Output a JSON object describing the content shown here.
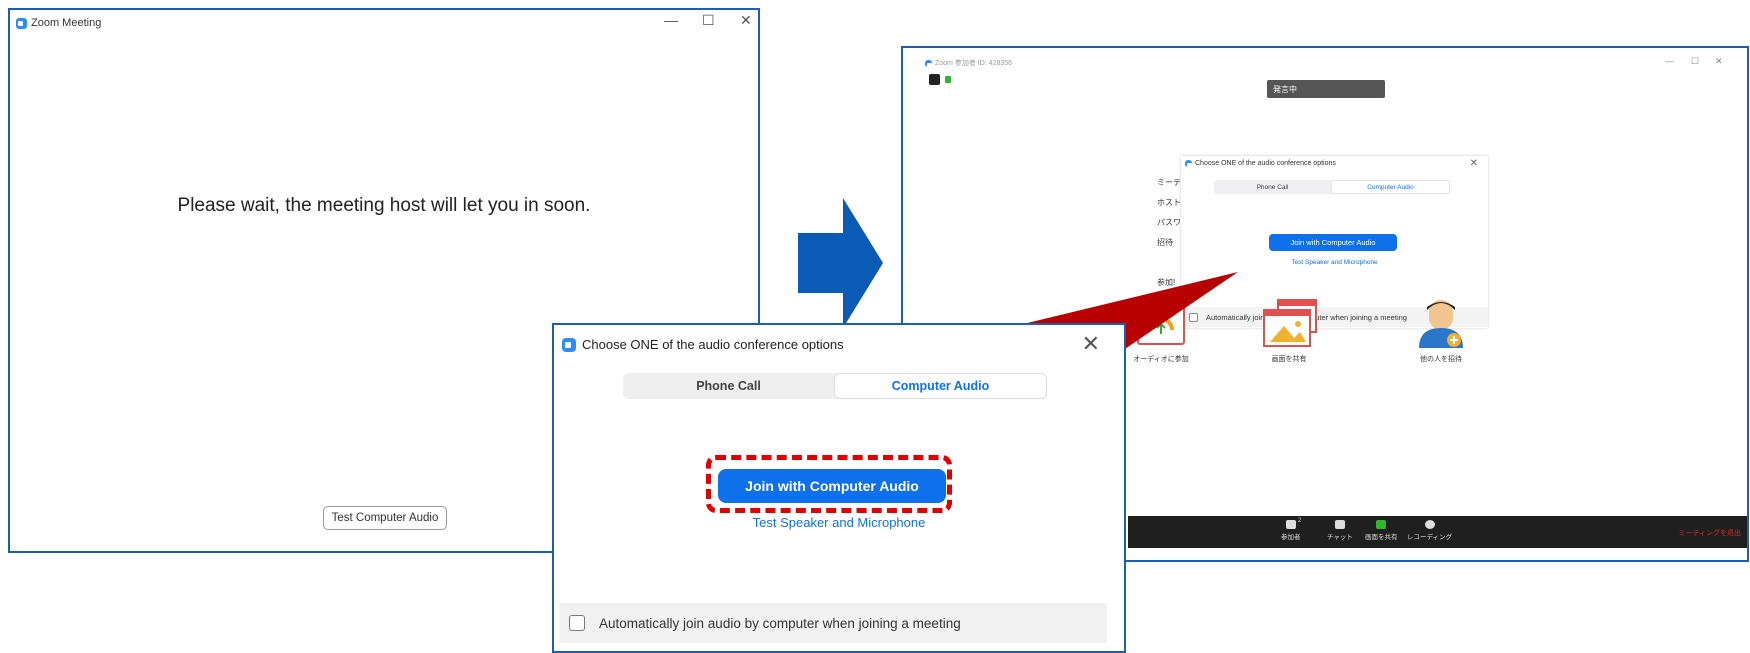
{
  "left_window": {
    "title": "Zoom Meeting",
    "controls": {
      "minimize": "—",
      "maximize": "☐",
      "close": "✕"
    },
    "message": "Please wait, the meeting host will let you in soon.",
    "test_audio_button": "Test Computer Audio"
  },
  "right_window": {
    "title": "Zoom 参加者 ID: 428356",
    "controls": {
      "minimize": "—",
      "maximize": "☐",
      "close": "✕"
    },
    "speaking_indicator": "発言中",
    "side_labels": [
      "ミーテ",
      "ホスト",
      "パスワ",
      "招待",
      "参加!"
    ],
    "mini_dialog": {
      "title": "Choose ONE of the audio conference options",
      "tabs": [
        "Phone Call",
        "Computer Audio"
      ],
      "join_button": "Join with Computer Audio",
      "test_link": "Test Speaker and Microphone",
      "auto_join_label": "Automatically join audio by computer when joining a meeting"
    },
    "features": [
      "オーディオに参加",
      "画面を共有",
      "他の人を招待"
    ],
    "toolbar": {
      "items": [
        "参加者",
        "チャット",
        "画面を共有",
        "レコーディング"
      ],
      "participant_count": "2",
      "end_meeting": "ミーティングを退出"
    }
  },
  "audio_dialog": {
    "title": "Choose ONE of the audio conference options",
    "close": "✕",
    "tabs": [
      "Phone Call",
      "Computer Audio"
    ],
    "active_tab": "Computer Audio",
    "join_button": "Join with Computer Audio",
    "test_link": "Test Speaker and Microphone",
    "auto_join_label": "Automatically join audio by computer when joining a meeting",
    "auto_join_checked": false
  },
  "colors": {
    "zoom_blue": "#0e71eb",
    "frame_blue": "#1a5fb4",
    "arrow_blue": "#0a5bb5",
    "highlight_red": "#e00000",
    "pointer_red": "#b80000"
  }
}
